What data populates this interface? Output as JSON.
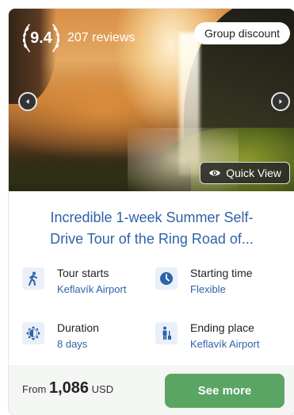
{
  "card": {
    "rating": {
      "score": "9.4",
      "reviews": "207 reviews"
    },
    "badge": "Group discount",
    "quick_view": "Quick View",
    "title_line1": "Incredible 1-week Summer Self-",
    "title_line2": "Drive Tour of the Ring Road of...",
    "info": [
      {
        "label": "Tour starts",
        "value": "Keflavík Airport",
        "icon": "hiker-icon"
      },
      {
        "label": "Starting time",
        "value": "Flexible",
        "icon": "clock-icon"
      },
      {
        "label": "Duration",
        "value": "8 days",
        "icon": "sun-icon"
      },
      {
        "label": "Ending place",
        "value": "Keflavík Airport",
        "icon": "person-flag-icon"
      }
    ],
    "price": {
      "from": "From",
      "amount": "1,086",
      "currency": "USD"
    },
    "cta": "See more"
  },
  "colors": {
    "link_blue": "#2f62a8",
    "cta_green": "#5aa564",
    "footer_bg": "#f3f6f3"
  }
}
